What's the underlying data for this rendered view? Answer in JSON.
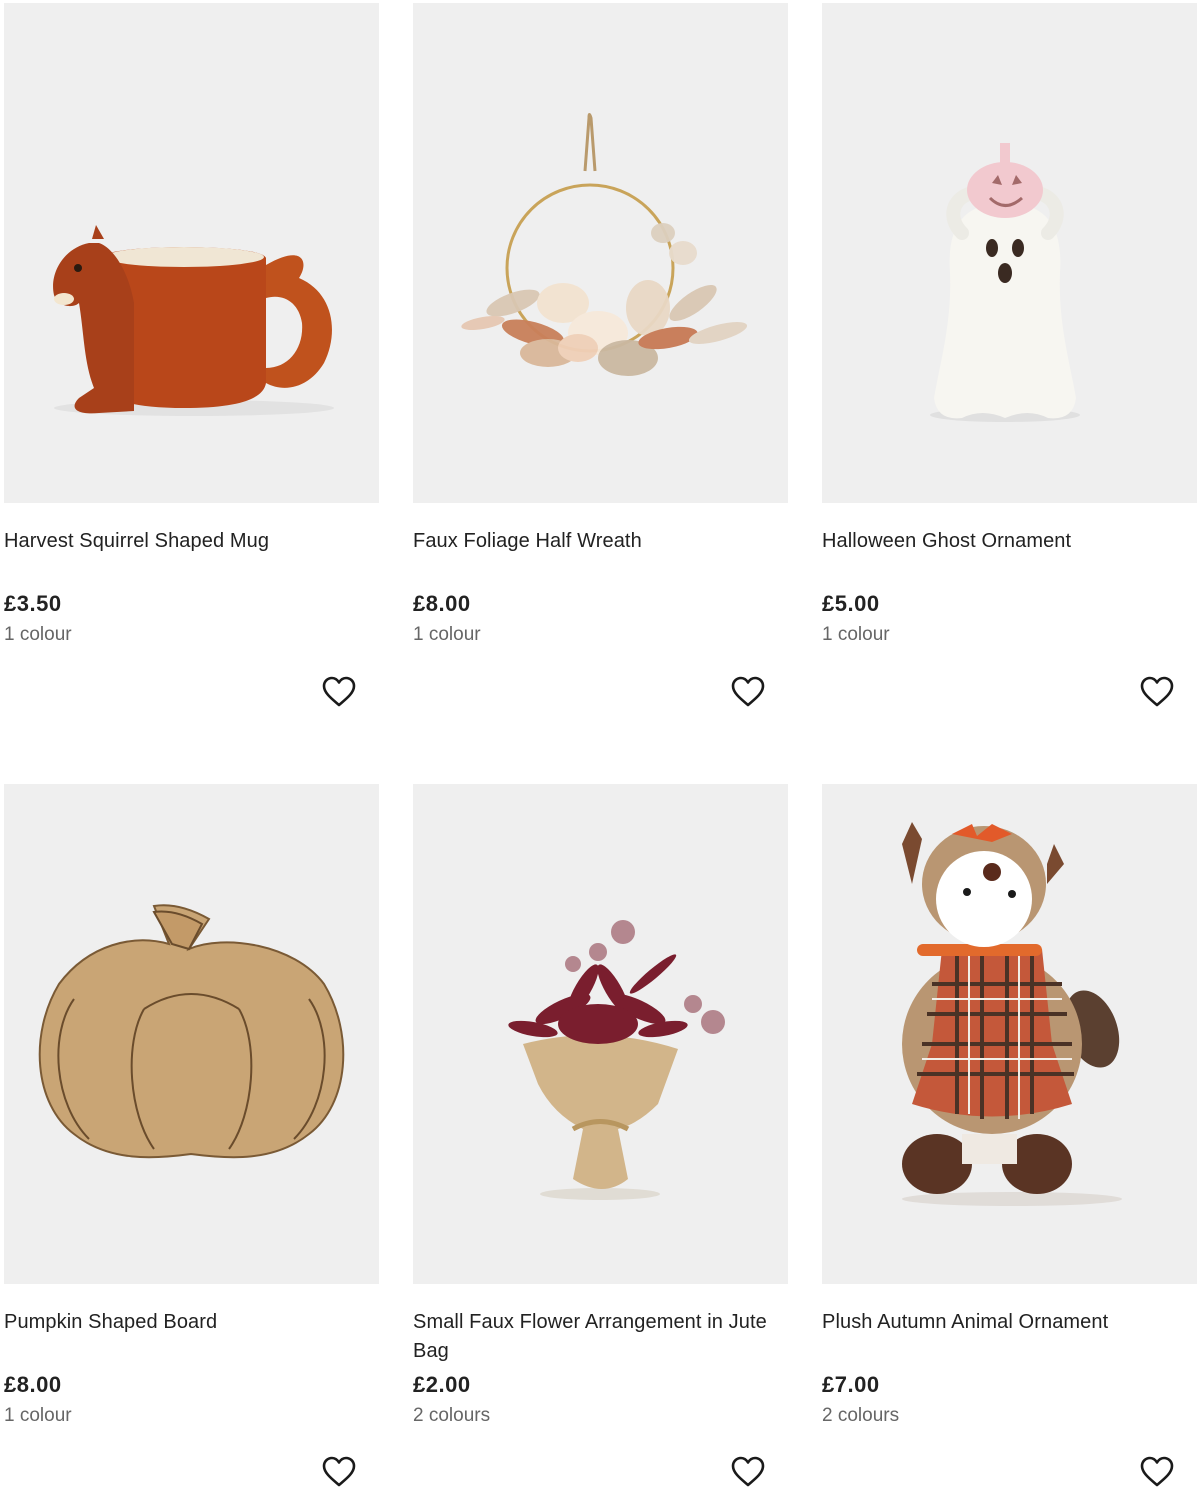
{
  "products": [
    {
      "name": "Harvest Squirrel Shaped Mug",
      "price": "£3.50",
      "colours": "1 colour",
      "image_icon": "squirrel-mug-image"
    },
    {
      "name": "Faux Foliage Half Wreath",
      "price": "£8.00",
      "colours": "1 colour",
      "image_icon": "half-wreath-image"
    },
    {
      "name": "Halloween Ghost Ornament",
      "price": "£5.00",
      "colours": "1 colour",
      "image_icon": "ghost-ornament-image"
    },
    {
      "name": "Pumpkin Shaped Board",
      "price": "£8.00",
      "colours": "1 colour",
      "image_icon": "pumpkin-board-image"
    },
    {
      "name": "Small Faux Flower Arrangement in Jute Bag",
      "price": "£2.00",
      "colours": "2 colours",
      "image_icon": "flower-arrangement-image"
    },
    {
      "name": "Plush Autumn Animal Ornament",
      "price": "£7.00",
      "colours": "2 colours",
      "image_icon": "plush-fox-image"
    }
  ],
  "wishlist_icon": "heart-icon",
  "colors": {
    "image_bg": "#efefef",
    "text": "#222222",
    "muted": "#666666"
  }
}
